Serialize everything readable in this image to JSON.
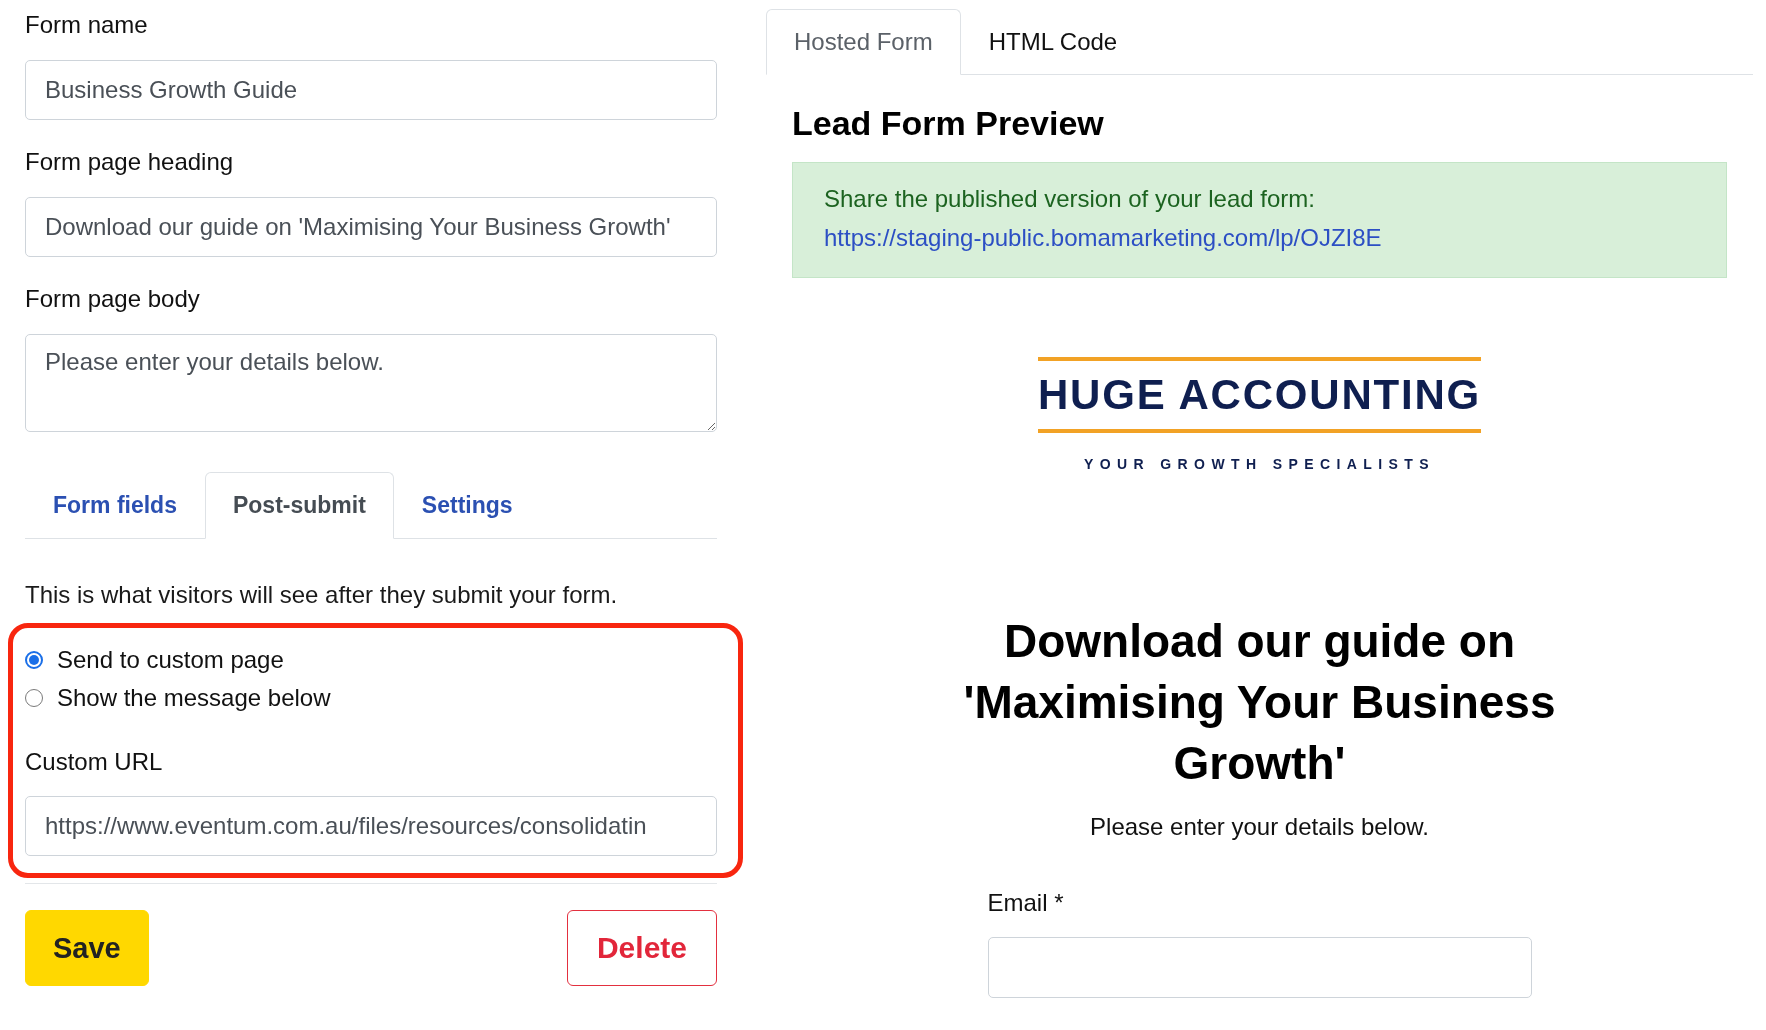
{
  "form_settings": {
    "fields": [
      {
        "kind": "text",
        "label": "Form name",
        "value": "Business Growth Guide"
      },
      {
        "kind": "text",
        "label": "Form page heading",
        "value": "Download our guide on 'Maximising Your Business Growth'"
      },
      {
        "kind": "textarea",
        "label": "Form page body",
        "value": "Please enter your details below."
      }
    ],
    "tabs": [
      {
        "label": "Form fields",
        "selected": false
      },
      {
        "label": "Post-submit",
        "selected": true
      },
      {
        "label": "Settings",
        "selected": false
      }
    ],
    "post_submit": {
      "description": "This is what visitors will see after they submit your form.",
      "highlighted": true,
      "options": [
        {
          "label": "Send to custom page",
          "selected": true
        },
        {
          "label": "Show the message below",
          "selected": false
        }
      ],
      "custom_url": {
        "label": "Custom URL",
        "value": "https://www.eventum.com.au/files/resources/consolidatin"
      }
    },
    "buttons": [
      {
        "kind": "primary",
        "label": "Save"
      },
      {
        "kind": "danger",
        "label": "Delete"
      }
    ]
  },
  "preview": {
    "tabs": [
      {
        "label": "Hosted Form",
        "selected": true
      },
      {
        "label": "HTML Code",
        "selected": false
      }
    ],
    "title": "Lead Form Preview",
    "share_notice": {
      "text": "Share the published version of your lead form:",
      "link": "https://staging-public.bomamarketing.com/lp/OJZI8E"
    },
    "hosted_form": {
      "logo": {
        "name": "HUGE ACCOUNTING",
        "tagline": "YOUR GROWTH SPECIALISTS"
      },
      "heading": "Download our guide on 'Maximising Your Business Growth'",
      "body": "Please enter your details below.",
      "fields": [
        {
          "label": "Email *"
        }
      ]
    }
  }
}
